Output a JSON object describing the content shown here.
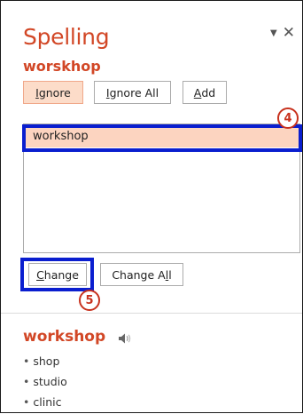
{
  "pane": {
    "title": "Spelling",
    "misspelled_word": "worskhop",
    "controls": {
      "dropdown_icon": "chevron-down-icon",
      "close_icon": "close-icon"
    }
  },
  "buttons": {
    "ignore": {
      "prefix": "",
      "accel": "I",
      "rest": "gnore"
    },
    "ignore_all": {
      "prefix": "",
      "accel": "I",
      "rest": "gnore All"
    },
    "add": {
      "prefix": "",
      "accel": "A",
      "rest": "dd"
    },
    "change": {
      "prefix": "",
      "accel": "C",
      "rest": "hange"
    },
    "change_all": {
      "prefix": "Change A",
      "accel": "l",
      "rest": "l"
    }
  },
  "suggestions": [
    "workshop"
  ],
  "callouts": {
    "four": "4",
    "five": "5"
  },
  "dictionary": {
    "word": "workshop",
    "speaker_icon": "speaker-icon",
    "synonyms": [
      "shop",
      "studio",
      "clinic"
    ]
  },
  "colors": {
    "accent": "#d24726",
    "selection": "#fcd4c0",
    "callout_box": "#0a1ecf",
    "badge": "#c8321e"
  }
}
